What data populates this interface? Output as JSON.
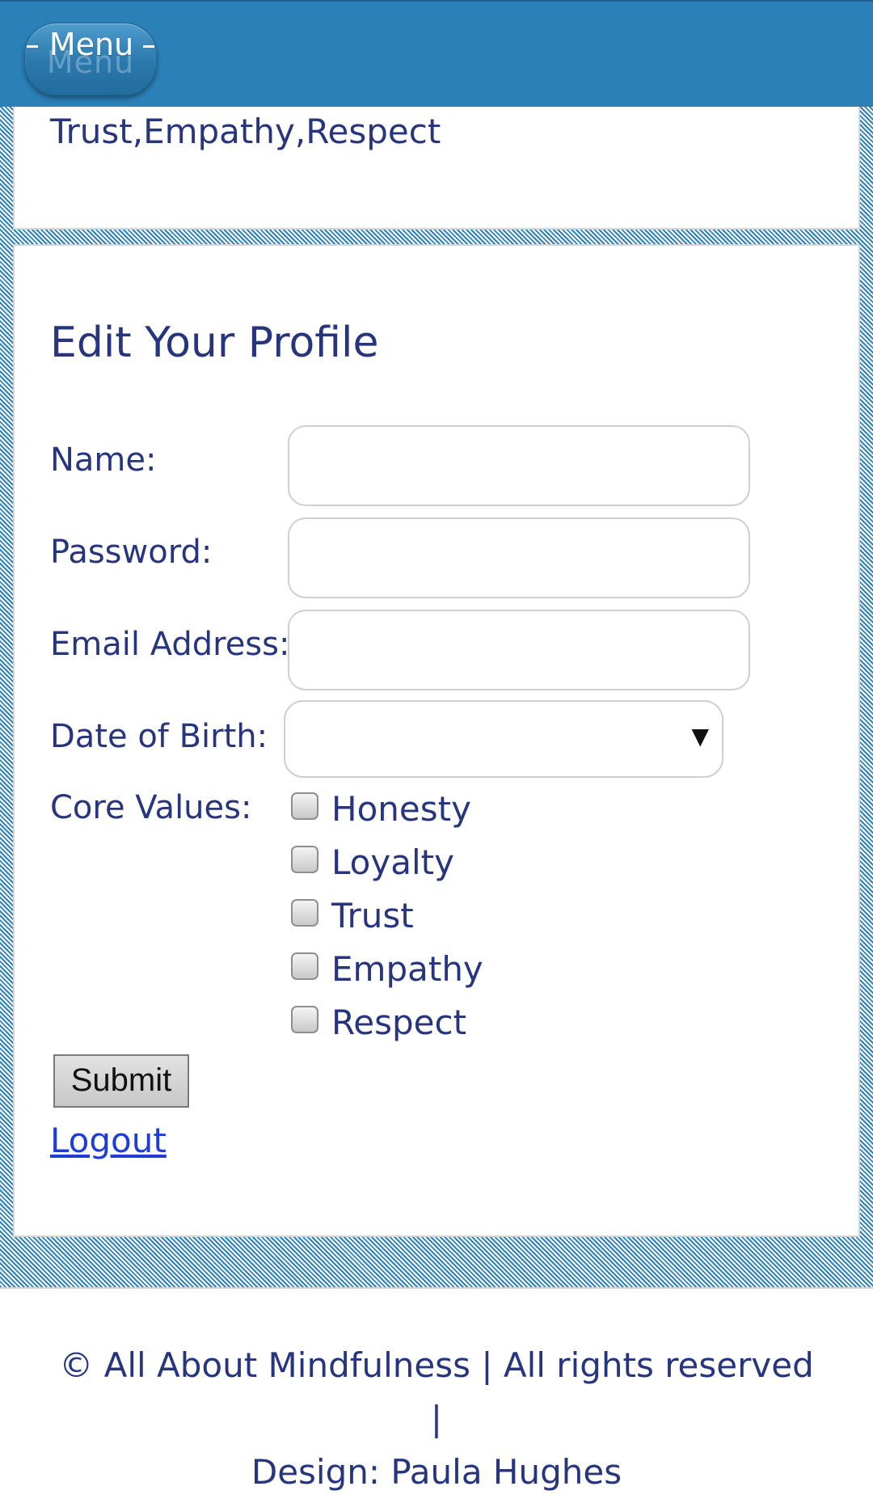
{
  "header": {
    "menu_label": "Menu"
  },
  "profile_summary": {
    "core_values_text": "Trust,Empathy,Respect"
  },
  "form": {
    "title": "Edit Your Profile",
    "name_label": "Name:",
    "name_value": "",
    "password_label": "Password:",
    "password_value": "",
    "email_label": "Email Address:",
    "email_value": "",
    "dob_label": "Date of Birth:",
    "dob_selected": "",
    "core_values_label": "Core Values:",
    "core_values": [
      {
        "label": "Honesty",
        "checked": false
      },
      {
        "label": "Loyalty",
        "checked": false
      },
      {
        "label": "Trust",
        "checked": false
      },
      {
        "label": "Empathy",
        "checked": false
      },
      {
        "label": "Respect",
        "checked": false
      }
    ],
    "submit_label": "Submit",
    "logout_label": "Logout"
  },
  "footer": {
    "line1": "© All About Mindfulness | All rights reserved |",
    "line2": "Design: Paula Hughes"
  },
  "icons": {
    "select_arrow": "dropdown-arrow-icon"
  },
  "colors": {
    "header_bg": "#2a80b7",
    "text": "#27357e",
    "link": "#1e3cd6"
  }
}
